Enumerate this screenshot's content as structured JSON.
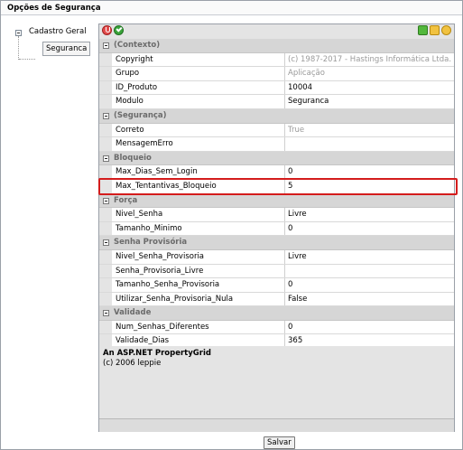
{
  "window": {
    "title": "Opções de Segurança"
  },
  "tree": {
    "root": "Cadastro Geral",
    "child": "Seguranca"
  },
  "toolbar": {
    "left_icons": [
      "categorized-view-icon",
      "alphabetical-view-icon"
    ],
    "right_icons": [
      "property-pages-icon",
      "events-icon",
      "expand-icon"
    ]
  },
  "grid": {
    "categories": [
      {
        "label": "(Contexto)",
        "props": [
          {
            "name": "Copyright",
            "value": "(c) 1987-2017 - Hastings Informática Ltda.",
            "readonly": true
          },
          {
            "name": "Grupo",
            "value": "Aplicação",
            "readonly": true
          },
          {
            "name": "ID_Produto",
            "value": "10004",
            "readonly": false
          },
          {
            "name": "Modulo",
            "value": "Seguranca",
            "readonly": false
          }
        ]
      },
      {
        "label": "(Segurança)",
        "props": [
          {
            "name": "Correto",
            "value": "True",
            "readonly": true
          },
          {
            "name": "MensagemErro",
            "value": "",
            "readonly": false
          }
        ]
      },
      {
        "label": "Bloqueio",
        "props": [
          {
            "name": "Max_Dias_Sem_Login",
            "value": "0",
            "readonly": false
          },
          {
            "name": "Max_Tentantivas_Bloqueio",
            "value": "5",
            "readonly": false
          }
        ]
      },
      {
        "label": "Força",
        "props": [
          {
            "name": "Nivel_Senha",
            "value": "Livre",
            "readonly": false
          },
          {
            "name": "Tamanho_Minimo",
            "value": "0",
            "readonly": false
          }
        ]
      },
      {
        "label": "Senha Provisória",
        "props": [
          {
            "name": "Nivel_Senha_Provisoria",
            "value": "Livre",
            "readonly": false
          },
          {
            "name": "Senha_Provisoria_Livre",
            "value": "",
            "readonly": false
          },
          {
            "name": "Tamanho_Senha_Provisoria",
            "value": "0",
            "readonly": false
          },
          {
            "name": "Utilizar_Senha_Provisoria_Nula",
            "value": "False",
            "readonly": false
          }
        ]
      },
      {
        "label": "Validade",
        "props": [
          {
            "name": "Num_Senhas_Diferentes",
            "value": "0",
            "readonly": false
          },
          {
            "name": "Validade_Dias",
            "value": "365",
            "readonly": false
          }
        ]
      }
    ],
    "highlighted_property": "Max_Tentantivas_Bloqueio"
  },
  "help": {
    "title": "An ASP.NET PropertyGrid",
    "description": "(c) 2006 leppie"
  },
  "footer": {
    "save_label": "Salvar"
  }
}
